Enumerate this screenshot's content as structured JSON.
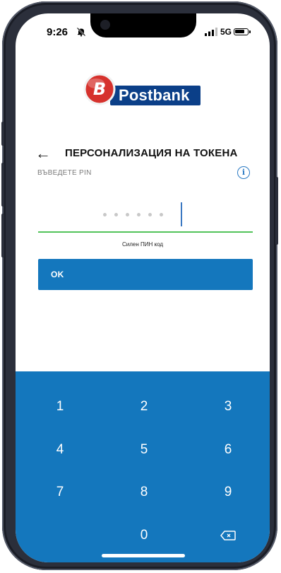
{
  "status_bar": {
    "time": "9:26",
    "network": "5G"
  },
  "brand": {
    "name": "Postbank",
    "badge_letter": "B",
    "colors": {
      "navy": "#0b3f88",
      "badge_red": "#d6322d"
    }
  },
  "header": {
    "back_icon": "←",
    "title": "ПЕРСОНАЛИЗАЦИЯ НА ТОКЕНА",
    "subtitle": "ВЪВЕДЕТЕ PIN",
    "info_icon": "i"
  },
  "pin": {
    "entered_count": 6,
    "strength_label": "Силен ПИН код",
    "strength_color": "#52c35a"
  },
  "actions": {
    "ok_label": "OK"
  },
  "keypad": {
    "keys": [
      "1",
      "2",
      "3",
      "4",
      "5",
      "6",
      "7",
      "8",
      "9",
      "0"
    ],
    "backspace_icon": "backspace-icon",
    "color": "#1477bd"
  }
}
